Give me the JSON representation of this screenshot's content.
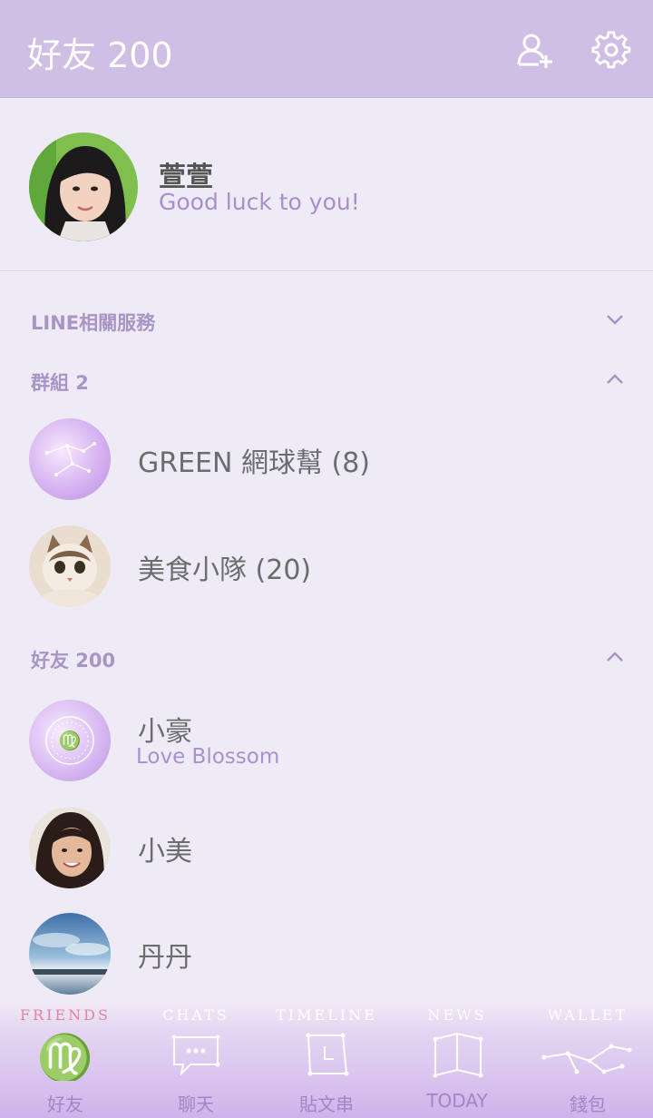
{
  "header": {
    "title": "好友 200",
    "add_friend_icon": "add-user-icon",
    "settings_icon": "gear-icon"
  },
  "profile": {
    "name": "萱萱",
    "status": "Good luck to you!"
  },
  "sections": {
    "line_services": "LINE相關服務",
    "groups": "群組 2",
    "friends": "好友 200"
  },
  "groups": [
    {
      "name": "GREEN 網球幫 (8)"
    },
    {
      "name": "美食小隊 (20)"
    }
  ],
  "friends": [
    {
      "name": "小豪",
      "status": "Love Blossom"
    },
    {
      "name": "小美"
    },
    {
      "name": "丹丹"
    }
  ],
  "nav": {
    "friends_en": "FRIENDS",
    "friends_label": "好友",
    "chats_en": "CHATS",
    "chats_label": "聊天",
    "timeline_en": "TIMELINE",
    "timeline_label": "貼文串",
    "news_en": "NEWS",
    "news_label": "TODAY",
    "wallet_en": "WALLET",
    "wallet_label": "錢包"
  },
  "colors": {
    "header": "#cfbfe5",
    "background": "#eeebf6",
    "accent": "#a78fcb"
  }
}
